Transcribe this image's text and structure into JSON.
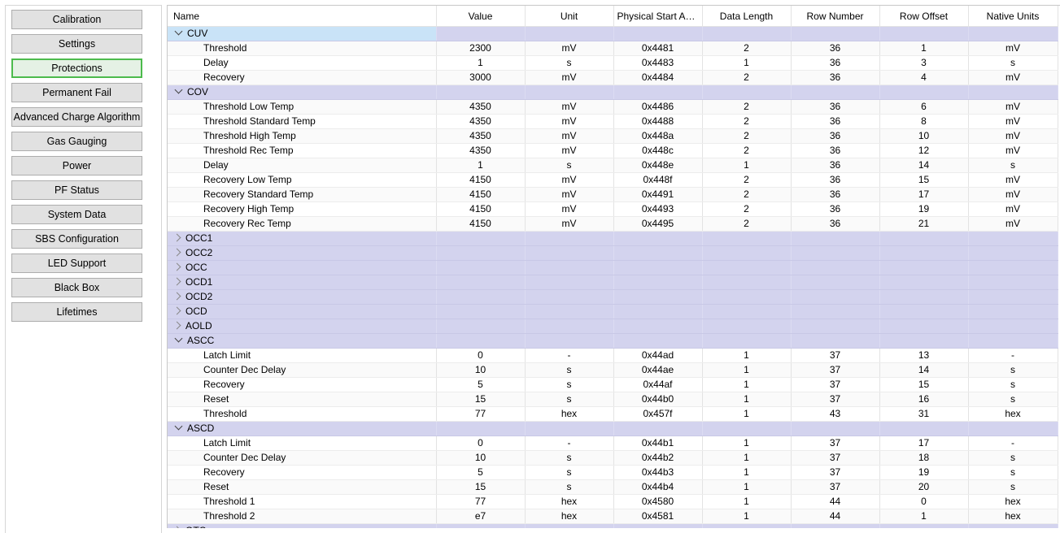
{
  "nav": {
    "buttons": [
      "Calibration",
      "Settings",
      "Protections",
      "Permanent Fail",
      "Advanced Charge Algorithm",
      "Gas Gauging",
      "Power",
      "PF Status",
      "System Data",
      "SBS Configuration",
      "LED Support",
      "Black Box",
      "Lifetimes"
    ],
    "selected": "Protections"
  },
  "grid": {
    "columns": [
      "Name",
      "Value",
      "Unit",
      "Physical Start Ad...",
      "Data Length",
      "Row Number",
      "Row Offset",
      "Native Units"
    ],
    "groups": [
      {
        "name": "CUV",
        "expanded": true,
        "rows": [
          [
            "Threshold",
            "2300",
            "mV",
            "0x4481",
            "2",
            "36",
            "1",
            "mV"
          ],
          [
            "Delay",
            "1",
            "s",
            "0x4483",
            "1",
            "36",
            "3",
            "s"
          ],
          [
            "Recovery",
            "3000",
            "mV",
            "0x4484",
            "2",
            "36",
            "4",
            "mV"
          ]
        ]
      },
      {
        "name": "COV",
        "expanded": true,
        "rows": [
          [
            "Threshold Low Temp",
            "4350",
            "mV",
            "0x4486",
            "2",
            "36",
            "6",
            "mV"
          ],
          [
            "Threshold Standard Temp",
            "4350",
            "mV",
            "0x4488",
            "2",
            "36",
            "8",
            "mV"
          ],
          [
            "Threshold High Temp",
            "4350",
            "mV",
            "0x448a",
            "2",
            "36",
            "10",
            "mV"
          ],
          [
            "Threshold Rec Temp",
            "4350",
            "mV",
            "0x448c",
            "2",
            "36",
            "12",
            "mV"
          ],
          [
            "Delay",
            "1",
            "s",
            "0x448e",
            "1",
            "36",
            "14",
            "s"
          ],
          [
            "Recovery Low Temp",
            "4150",
            "mV",
            "0x448f",
            "2",
            "36",
            "15",
            "mV"
          ],
          [
            "Recovery Standard Temp",
            "4150",
            "mV",
            "0x4491",
            "2",
            "36",
            "17",
            "mV"
          ],
          [
            "Recovery High Temp",
            "4150",
            "mV",
            "0x4493",
            "2",
            "36",
            "19",
            "mV"
          ],
          [
            "Recovery Rec Temp",
            "4150",
            "mV",
            "0x4495",
            "2",
            "36",
            "21",
            "mV"
          ]
        ]
      },
      {
        "name": "OCC1",
        "expanded": false,
        "rows": []
      },
      {
        "name": "OCC2",
        "expanded": false,
        "rows": []
      },
      {
        "name": "OCC",
        "expanded": false,
        "rows": []
      },
      {
        "name": "OCD1",
        "expanded": false,
        "rows": []
      },
      {
        "name": "OCD2",
        "expanded": false,
        "rows": []
      },
      {
        "name": "OCD",
        "expanded": false,
        "rows": []
      },
      {
        "name": "AOLD",
        "expanded": false,
        "rows": []
      },
      {
        "name": "ASCC",
        "expanded": true,
        "rows": [
          [
            "Latch Limit",
            "0",
            "-",
            "0x44ad",
            "1",
            "37",
            "13",
            "-"
          ],
          [
            "Counter Dec Delay",
            "10",
            "s",
            "0x44ae",
            "1",
            "37",
            "14",
            "s"
          ],
          [
            "Recovery",
            "5",
            "s",
            "0x44af",
            "1",
            "37",
            "15",
            "s"
          ],
          [
            "Reset",
            "15",
            "s",
            "0x44b0",
            "1",
            "37",
            "16",
            "s"
          ],
          [
            "Threshold",
            "77",
            "hex",
            "0x457f",
            "1",
            "43",
            "31",
            "hex"
          ]
        ]
      },
      {
        "name": "ASCD",
        "expanded": true,
        "rows": [
          [
            "Latch Limit",
            "0",
            "-",
            "0x44b1",
            "1",
            "37",
            "17",
            "-"
          ],
          [
            "Counter Dec Delay",
            "10",
            "s",
            "0x44b2",
            "1",
            "37",
            "18",
            "s"
          ],
          [
            "Recovery",
            "5",
            "s",
            "0x44b3",
            "1",
            "37",
            "19",
            "s"
          ],
          [
            "Reset",
            "15",
            "s",
            "0x44b4",
            "1",
            "37",
            "20",
            "s"
          ],
          [
            "Threshold 1",
            "77",
            "hex",
            "0x4580",
            "1",
            "44",
            "0",
            "hex"
          ],
          [
            "Threshold 2",
            "e7",
            "hex",
            "0x4581",
            "1",
            "44",
            "1",
            "hex"
          ]
        ]
      },
      {
        "name": "OTC",
        "expanded": false,
        "rows": []
      }
    ]
  }
}
